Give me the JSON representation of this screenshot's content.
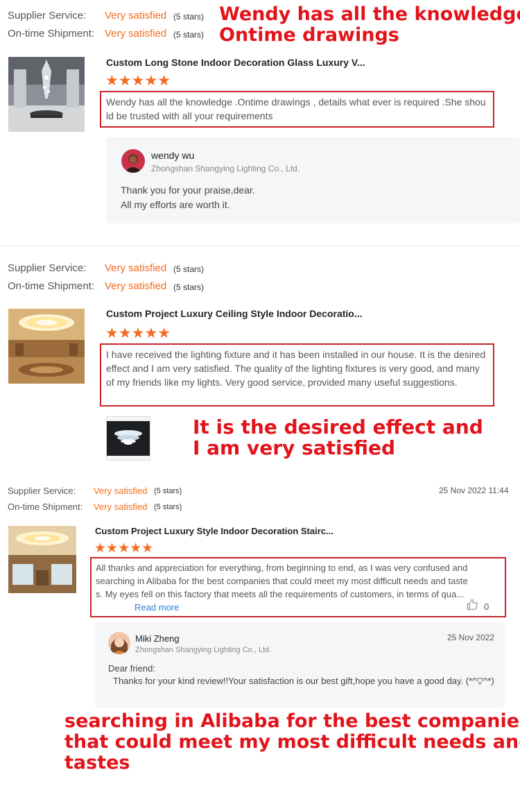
{
  "annotations": {
    "top_line1": "Wendy has all the knowledge",
    "top_line2": "Ontime drawings",
    "mid_line1": "It is the desired effect and",
    "mid_line2": "I am very satisfied",
    "bottom_line1": "searching in Alibaba for the best companies",
    "bottom_line2": "that could meet my most difficult needs and",
    "bottom_line3": "tastes"
  },
  "reviews": [
    {
      "supplier_service_label": "Supplier Service:",
      "supplier_service_value": "Very satisfied",
      "supplier_service_stars": "(5 stars)",
      "shipment_label": "On-time Shipment:",
      "shipment_value": "Very satisfied",
      "shipment_stars": "(5 stars)",
      "product_title": "Custom Long Stone Indoor Decoration Glass Luxury V...",
      "rating": "★★★★★",
      "text": "Wendy has all the knowledge .Ontime drawings , details what ever is required .She should be trusted with all your requirements",
      "reply": {
        "name": "wendy wu",
        "company": "Zhongshan Shangying Lighting Co., Ltd.",
        "line1": "Thank you for your praise,dear.",
        "line2": "All my efforts are worth it."
      }
    },
    {
      "supplier_service_label": "Supplier Service:",
      "supplier_service_value": "Very satisfied",
      "supplier_service_stars": "(5 stars)",
      "shipment_label": "On-time Shipment:",
      "shipment_value": "Very satisfied",
      "shipment_stars": "(5 stars)",
      "product_title": "Custom Project Luxury Ceiling Style Indoor Decoratio...",
      "rating": "★★★★★",
      "text": "I have received the lighting fixture and it has been installed in our house. It is the desired effect and I am very satisfied. The quality of the lighting fixtures is very good, and many of my friends like my lights. Very good service, provided many useful suggestions."
    },
    {
      "supplier_service_label": "Supplier Service:",
      "supplier_service_value": "Very satisfied",
      "supplier_service_stars": "(5 stars)",
      "shipment_label": "On-time Shipment:",
      "shipment_value": "Very satisfied",
      "shipment_stars": "(5 stars)",
      "date": "25 Nov 2022 11:44",
      "product_title": "Custom Project Luxury Style Indoor Decoration Stairc...",
      "rating": "★★★★★",
      "text": "All thanks and appreciation for everything, from beginning to end, as I was very confused and searching in Alibaba for the best companies that could meet my most difficult needs and tastes. My eyes fell on this factory that meets all the requirements of customers, in terms of qua...",
      "read_more": "Read more",
      "like_count": "0",
      "reply": {
        "name": "Miki Zheng",
        "company": "Zhongshan Shangying Lighting Co., Ltd.",
        "date": "25 Nov 2022",
        "line1": "Dear friend:",
        "line2": "Thanks for your kind review!!Your satisfaction is our best gift,hope you have a good day. (*^▽^*)"
      }
    }
  ],
  "icons": {
    "like": "thumbs-up-icon"
  },
  "colors": {
    "accent": "#f36c21",
    "annotation_red": "#e3131b",
    "box_red": "#c9242b",
    "link_blue": "#2b7bd6"
  }
}
